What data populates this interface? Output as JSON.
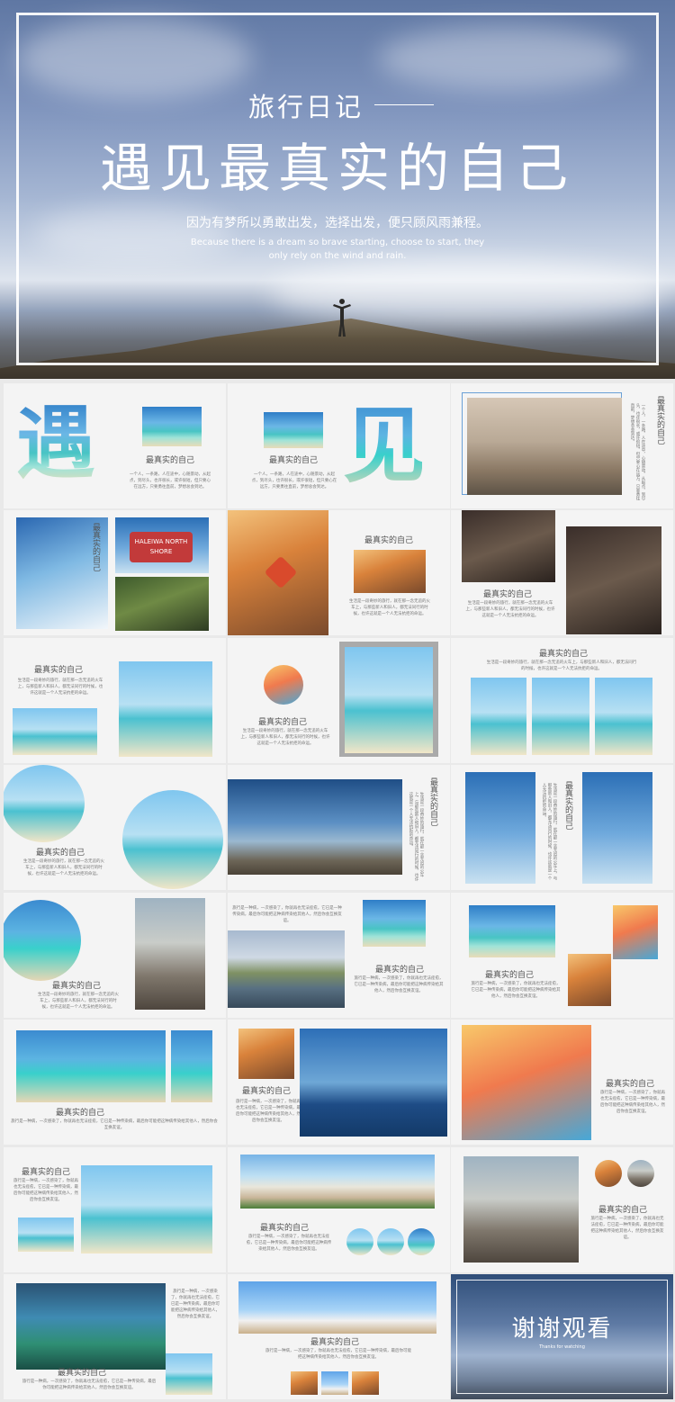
{
  "hero": {
    "subtitle": "旅行日记",
    "title": "遇见最真实的自己",
    "tagline_cn": "因为有梦所以勇敢出发，选择出发，便只顾风雨兼程。",
    "tagline_en": "Because there is a dream so brave starting, choose to start, they only rely on the wind and rain."
  },
  "caption": "最真实的自己",
  "big_char_1": "遇",
  "big_char_2": "见",
  "sign_text": "HALEIWA NORTH SHORE",
  "body_text": "一个人，一条路，人在途中，心随景动，从起点，到尽头，也许很长，或许很短，但只要心在远方，只要勇往直前，梦想总会到达。",
  "body_text_b": "生活是一段奇妙的旅行，就在那一念无追的火车上，与那些新人和旧人，都无法同行的时候，也许这就是一个人无法抗拒的命运。",
  "body_text_c": "旅行是一种病，一次感染了，你就再也无法痊愈，它已是一种传染病，最后你可能把这种病传染给其他人，然后你会互换友谊。",
  "thanks": {
    "title": "谢谢观看",
    "subtitle": "Thanks for watching"
  }
}
